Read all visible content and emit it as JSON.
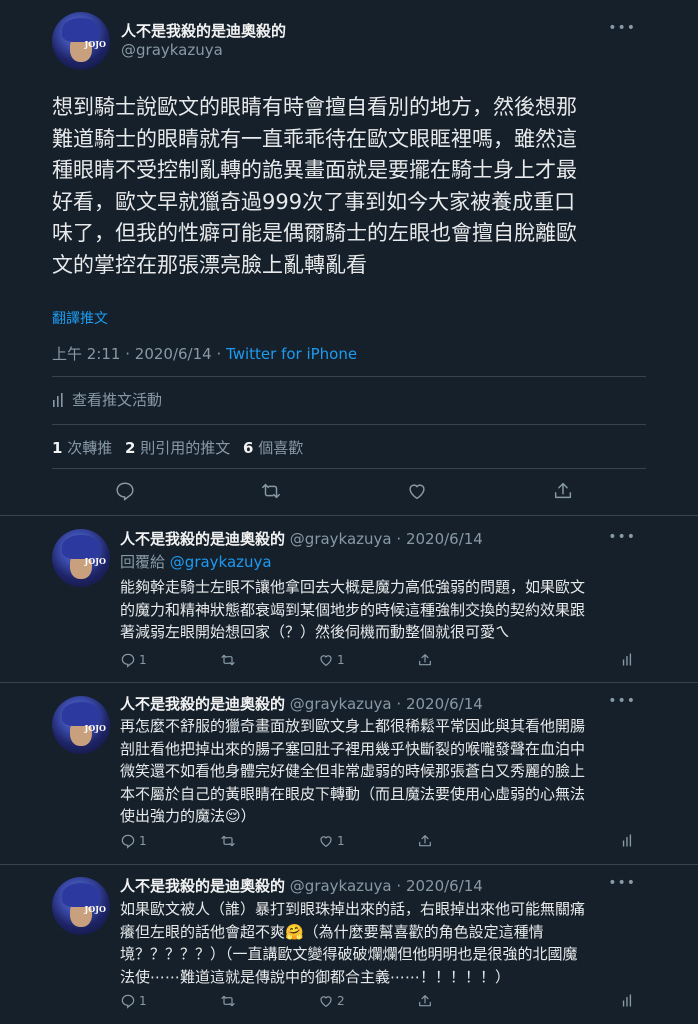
{
  "main_tweet": {
    "display_name": "人不是我殺的是迪奧殺的",
    "handle": "@graykazuya",
    "avatar_badge": "JOJO",
    "text_lines": [
      "想到騎士說歐文的眼睛有時會擅自看別的地方，然後想那",
      "難道騎士的眼睛就有一直乖乖待在歐文眼眶裡嗎，雖然這",
      "種眼睛不受控制亂轉的詭異畫面就是要擺在騎士身上才最",
      "好看，歐文早就獵奇過999次了事到如今大家被養成重口",
      "味了，但我的性癖可能是偶爾騎士的左眼也會擅自脫離歐",
      "文的掌控在那張漂亮臉上亂轉亂看"
    ],
    "translate_label": "翻譯推文",
    "time": "上午 2:11",
    "date": "2020/6/14",
    "source": "Twitter for iPhone",
    "activity_label": "查看推文活動",
    "stats": {
      "retweets_count": "1",
      "retweets_label": "次轉推",
      "quotes_count": "2",
      "quotes_label": "則引用的推文",
      "likes_count": "6",
      "likes_label": "個喜歡"
    }
  },
  "replies": [
    {
      "display_name": "人不是我殺的是迪奧殺的",
      "handle": "@graykazuya",
      "date": "2020/6/14",
      "replying_label": "回覆給",
      "replying_to": "@graykazuya",
      "text_lines": [
        "能夠幹走騎士左眼不讓他拿回去大概是魔力高低強弱的問題，如果歐文",
        "的魔力和精神狀態都衰竭到某個地步的時候這種強制交換的契約效果跟",
        "著減弱左眼開始想回家（？）然後伺機而動整個就很可愛ㄟ"
      ],
      "reply_count": "1",
      "retweet_count": "",
      "like_count": "1"
    },
    {
      "display_name": "人不是我殺的是迪奧殺的",
      "handle": "@graykazuya",
      "date": "2020/6/14",
      "text_lines": [
        "再怎麼不舒服的獵奇畫面放到歐文身上都很稀鬆平常因此與其看他開腸",
        "剖肚看他把掉出來的腸子塞回肚子裡用幾乎快斷裂的喉嚨發聲在血泊中",
        "微笑還不如看他身體完好健全但非常虛弱的時候那張蒼白又秀麗的臉上",
        "本不屬於自己的黃眼睛在眼皮下轉動（而且魔法要使用心虛弱的心無法",
        "使出強力的魔法😌）"
      ],
      "reply_count": "1",
      "retweet_count": "",
      "like_count": "1"
    },
    {
      "display_name": "人不是我殺的是迪奧殺的",
      "handle": "@graykazuya",
      "date": "2020/6/14",
      "text_lines": [
        "如果歐文被人（誰）暴打到眼珠掉出來的話，右眼掉出來他可能無關痛",
        "癢但左眼的話他會超不爽🤗（為什麼要幫喜歡的角色設定這種情",
        "境？？？？？）（一直講歐文變得破破爛爛但他明明也是很強的北國魔",
        "法使⋯⋯難道這就是傳說中的御都合主義⋯⋯！！！！！）"
      ],
      "reply_count": "1",
      "retweet_count": "",
      "like_count": "2"
    }
  ],
  "icons": [
    "more-icon",
    "reply-icon",
    "retweet-icon",
    "like-icon",
    "share-icon",
    "analytics-icon"
  ],
  "colors": {
    "background": "#15202b",
    "accent": "#1d9bf0",
    "muted": "#8899a6",
    "divider": "#38444d"
  }
}
